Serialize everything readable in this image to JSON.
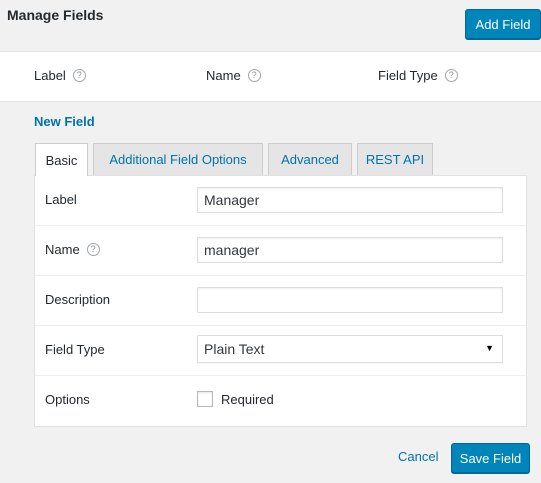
{
  "page": {
    "title": "Manage Fields",
    "add_button": "Add Field"
  },
  "columns": {
    "label": "Label",
    "name": "Name",
    "field_type": "Field Type",
    "help_glyph": "?"
  },
  "new_field_link": "New Field",
  "tabs": [
    {
      "label": "Basic",
      "active": true
    },
    {
      "label": "Additional Field Options",
      "active": false
    },
    {
      "label": "Advanced",
      "active": false
    },
    {
      "label": "REST API",
      "active": false
    }
  ],
  "form": {
    "label": {
      "label": "Label",
      "value": "Manager"
    },
    "name": {
      "label": "Name",
      "value": "manager"
    },
    "description": {
      "label": "Description",
      "value": ""
    },
    "field_type": {
      "label": "Field Type",
      "selected": "Plain Text"
    },
    "options": {
      "label": "Options",
      "required_label": "Required",
      "required_checked": false
    }
  },
  "actions": {
    "cancel": "Cancel",
    "save": "Save Field"
  },
  "colors": {
    "primary": "#0085ba",
    "link": "#0073aa",
    "background": "#f1f1f1"
  }
}
